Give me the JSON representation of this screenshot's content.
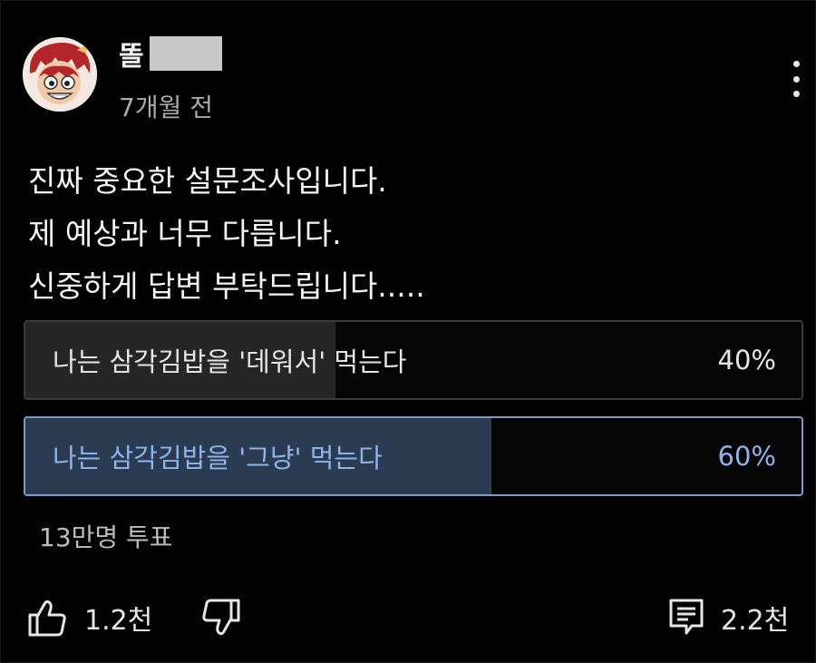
{
  "post": {
    "author": "똘",
    "time_ago": "7개월 전",
    "body": "진짜 중요한 설문조사입니다.\n제 예상과 너무 다릅니다.\n신중하게 답변 부탁드립니다....."
  },
  "poll": {
    "options": [
      {
        "label": "나는 삼각김밥을 '데워서' 먹는다",
        "percent_text": "40%",
        "percent": 40,
        "selected": false
      },
      {
        "label": "나는 삼각김밥을 '그냥' 먹는다",
        "percent_text": "60%",
        "percent": 60,
        "selected": true
      }
    ],
    "votes": "13만명 투표"
  },
  "actions": {
    "likes": "1.2천",
    "comments": "2.2천"
  },
  "icons": {
    "avatar": "cartoon-avatar",
    "more": "more-vertical-icon",
    "like": "thumbs-up-icon",
    "dislike": "thumbs-down-icon",
    "comment": "comment-icon"
  },
  "colors": {
    "background": "#020202",
    "selected_accent": "#8fb4ea",
    "selected_fill": "#2a3b52",
    "unselected_fill": "#262626"
  }
}
